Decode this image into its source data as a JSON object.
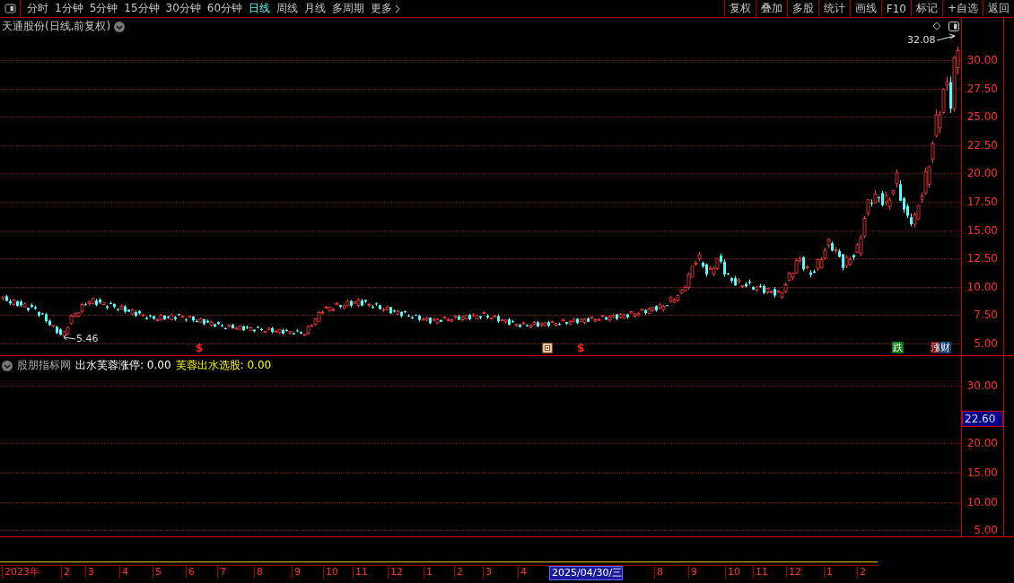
{
  "toolbar": {
    "tabs": [
      {
        "label": "分时",
        "selected": false
      },
      {
        "label": "1分钟",
        "selected": false
      },
      {
        "label": "5分钟",
        "selected": false
      },
      {
        "label": "15分钟",
        "selected": false
      },
      {
        "label": "30分钟",
        "selected": false
      },
      {
        "label": "60分钟",
        "selected": false
      },
      {
        "label": "日线",
        "selected": true
      },
      {
        "label": "周线",
        "selected": false
      },
      {
        "label": "月线",
        "selected": false
      },
      {
        "label": "多周期",
        "selected": false
      },
      {
        "label": "更多",
        "selected": false
      }
    ],
    "buttons": [
      "复权",
      "叠加",
      "多股",
      "统计",
      "画线",
      "F10",
      "标记",
      "+自选",
      "返回"
    ]
  },
  "main": {
    "title": "天通股份(日线,前复权)",
    "high_label": "32.08",
    "low_label": "5.46",
    "axis": [
      "30.00",
      "27.50",
      "25.00",
      "22.50",
      "20.00",
      "17.50",
      "15.00",
      "12.50",
      "10.00",
      "7.50",
      "5.00"
    ],
    "signals": [
      {
        "kind": "dollar",
        "text": "$"
      },
      {
        "kind": "box"
      },
      {
        "kind": "dollar",
        "text": "$"
      },
      {
        "kind": "fall",
        "text": "跌"
      },
      {
        "kind": "rise",
        "text": "涨"
      },
      {
        "kind": "finance",
        "text": "财"
      }
    ]
  },
  "indicator": {
    "source": "股朋指标网",
    "lines": [
      {
        "name": "出水芙蓉涨停:",
        "value": "0.00",
        "color": "#ffffff"
      },
      {
        "name": "芙蓉出水选股:",
        "value": "0.00",
        "color": "#ffff00"
      }
    ],
    "axis": [
      "30.00",
      "20.00",
      "15.00",
      "10.00",
      "5.00"
    ],
    "current": "22.60"
  },
  "dates": [
    {
      "text": "2023年",
      "selected": false
    },
    {
      "text": "2",
      "selected": false
    },
    {
      "text": "3",
      "selected": false
    },
    {
      "text": "4",
      "selected": false
    },
    {
      "text": "5",
      "selected": false
    },
    {
      "text": "6",
      "selected": false
    },
    {
      "text": "7",
      "selected": false
    },
    {
      "text": "8",
      "selected": false
    },
    {
      "text": "9",
      "selected": false
    },
    {
      "text": "10",
      "selected": false
    },
    {
      "text": "11",
      "selected": false
    },
    {
      "text": "12",
      "selected": false
    },
    {
      "text": "1",
      "selected": false
    },
    {
      "text": "2",
      "selected": false
    },
    {
      "text": "3",
      "selected": false
    },
    {
      "text": "4",
      "selected": false
    },
    {
      "text": "2025/04/30/三",
      "selected": true
    },
    {
      "text": "8",
      "selected": false
    },
    {
      "text": "9",
      "selected": false
    },
    {
      "text": "10",
      "selected": false
    },
    {
      "text": "11",
      "selected": false
    },
    {
      "text": "12",
      "selected": false
    },
    {
      "text": "1",
      "selected": false
    },
    {
      "text": "2",
      "selected": false
    }
  ]
}
